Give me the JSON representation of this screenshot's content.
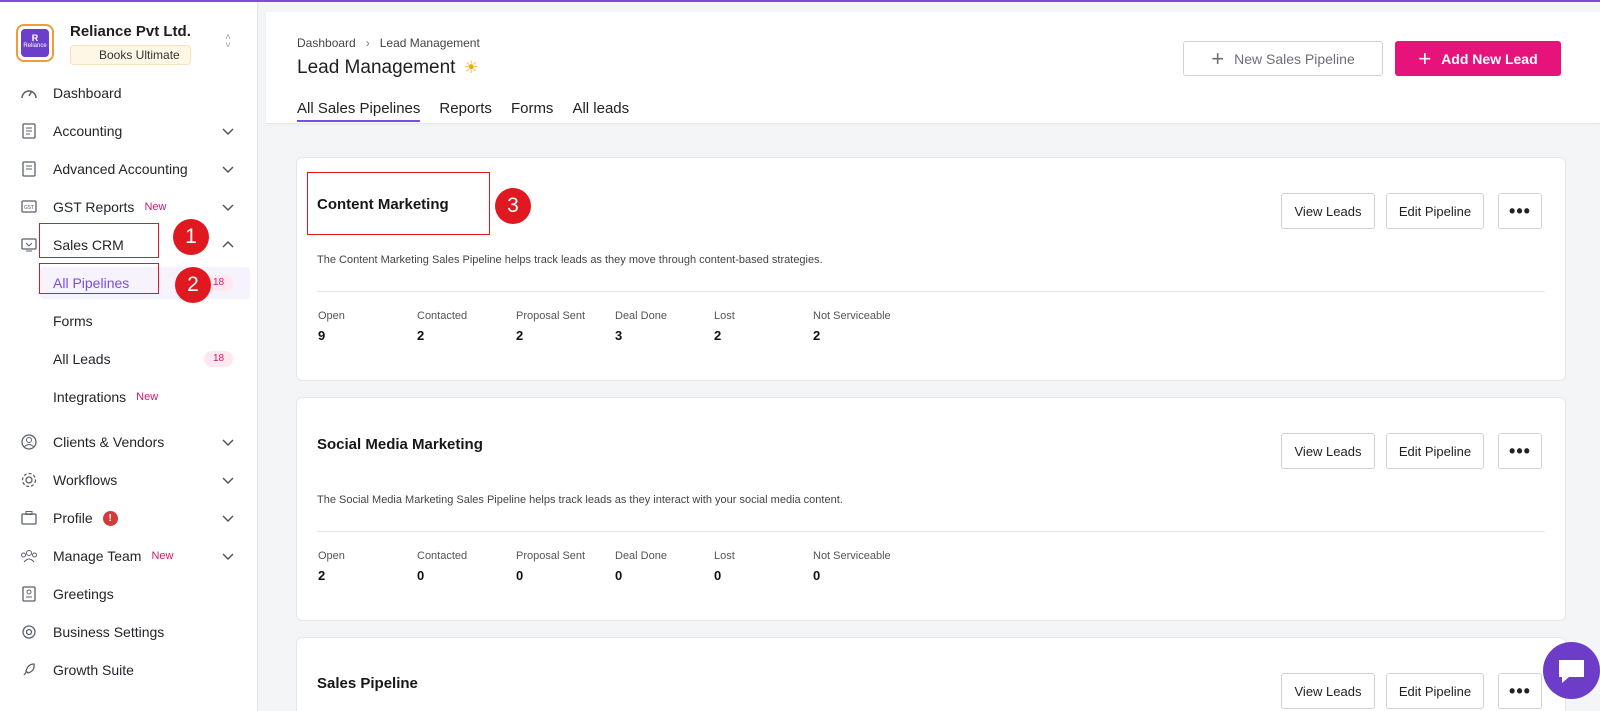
{
  "org": {
    "name": "Reliance Pvt Ltd.",
    "plan": "Books Ultimate",
    "logo_text": "Reliance"
  },
  "sidebar": {
    "items": [
      {
        "label": "Dashboard",
        "icon": "speedometer-icon"
      },
      {
        "label": "Accounting",
        "icon": "document-icon"
      },
      {
        "label": "Advanced Accounting",
        "icon": "document-icon"
      },
      {
        "label": "GST Reports",
        "icon": "gst-icon",
        "badge": "New"
      },
      {
        "label": "Sales CRM",
        "icon": "crm-icon"
      },
      {
        "label": "All Pipelines",
        "count": "18"
      },
      {
        "label": "Forms"
      },
      {
        "label": "All Leads",
        "count": "18"
      },
      {
        "label": "Integrations",
        "badge": "New"
      },
      {
        "label": "Clients & Vendors",
        "icon": "person-icon"
      },
      {
        "label": "Workflows",
        "icon": "workflow-gear-icon"
      },
      {
        "label": "Profile",
        "icon": "briefcase-icon",
        "alert": "!"
      },
      {
        "label": "Manage Team",
        "icon": "team-icon",
        "badge": "New"
      },
      {
        "label": "Greetings",
        "icon": "greetings-icon"
      },
      {
        "label": "Business Settings",
        "icon": "gear-icon"
      },
      {
        "label": "Growth Suite",
        "icon": "rocket-icon"
      }
    ]
  },
  "header": {
    "breadcrumb": [
      "Dashboard",
      "Lead Management"
    ],
    "title": "Lead Management",
    "tabs": [
      "All Sales Pipelines",
      "Reports",
      "Forms",
      "All leads"
    ],
    "new_pipeline_label": "New Sales Pipeline",
    "add_lead_label": "Add New Lead"
  },
  "stat_labels": [
    "Open",
    "Contacted",
    "Proposal Sent",
    "Deal Done",
    "Lost",
    "Not Serviceable"
  ],
  "pipelines": [
    {
      "title": "Content Marketing",
      "desc": "The Content Marketing Sales Pipeline helps track leads as they move through content-based strategies.",
      "values": [
        "9",
        "2",
        "2",
        "3",
        "2",
        "2"
      ],
      "view_label": "View Leads",
      "edit_label": "Edit Pipeline"
    },
    {
      "title": "Social Media Marketing",
      "desc": "The Social Media Marketing Sales Pipeline helps track leads as they interact with your social media content.",
      "values": [
        "2",
        "0",
        "0",
        "0",
        "0",
        "0"
      ],
      "view_label": "View Leads",
      "edit_label": "Edit Pipeline"
    },
    {
      "title": "Sales Pipeline",
      "view_label": "View Leads",
      "edit_label": "Edit Pipeline"
    }
  ],
  "annotations": [
    "1",
    "2",
    "3"
  ],
  "colors": {
    "accent": "#7c4ddc",
    "primary": "#e6147a",
    "annotation": "#e0181f"
  }
}
